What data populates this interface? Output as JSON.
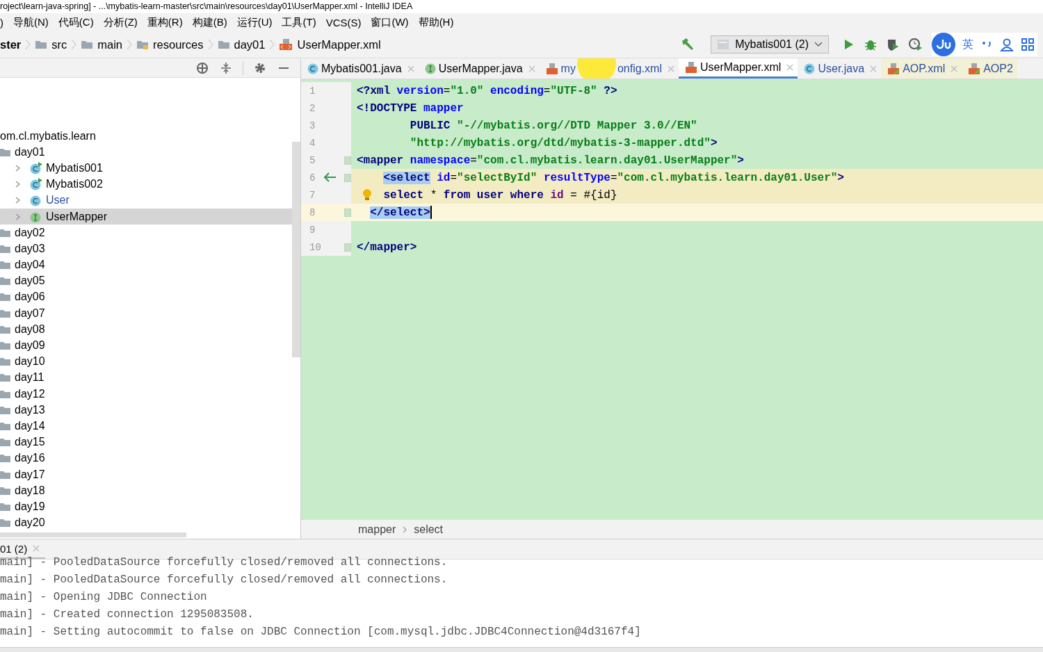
{
  "window": {
    "title": "roject\\learn-java-spring] - ...\\mybatis-learn-master\\src\\main\\resources\\day01\\UserMapper.xml - IntelliJ IDEA"
  },
  "menu": [
    ")",
    "导航(N)",
    "代码(C)",
    "分析(Z)",
    "重构(R)",
    "构建(B)",
    "运行(U)",
    "工具(T)",
    "VCS(S)",
    "窗口(W)",
    "帮助(H)"
  ],
  "breadcrumb": [
    {
      "label": "ster",
      "kind": "module"
    },
    {
      "label": "src",
      "kind": "folder"
    },
    {
      "label": "main",
      "kind": "folder"
    },
    {
      "label": "resources",
      "kind": "resources"
    },
    {
      "label": "day01",
      "kind": "folder"
    },
    {
      "label": "UserMapper.xml",
      "kind": "xml"
    }
  ],
  "run_config": {
    "label": "Mybatis001 (2)"
  },
  "ime": {
    "language": "英"
  },
  "project_tree": [
    {
      "label": "om.cl.mybatis.learn",
      "selected": false,
      "children": [
        {
          "label": "day01",
          "kind": "folder",
          "selected": false,
          "children": [
            {
              "label": "Mybatis001",
              "kind": "class-run",
              "selected": false
            },
            {
              "label": "Mybatis002",
              "kind": "class-run",
              "selected": false
            },
            {
              "label": "User",
              "kind": "class",
              "selected": false
            },
            {
              "label": "UserMapper",
              "kind": "interface",
              "selected": true
            }
          ]
        },
        {
          "label": "day02",
          "kind": "folder",
          "selected": false
        },
        {
          "label": "day03",
          "kind": "folder",
          "selected": false
        },
        {
          "label": "day04",
          "kind": "folder",
          "selected": false
        },
        {
          "label": "day05",
          "kind": "folder",
          "selected": false
        },
        {
          "label": "day06",
          "kind": "folder",
          "selected": false
        },
        {
          "label": "day07",
          "kind": "folder",
          "selected": false
        },
        {
          "label": "day08",
          "kind": "folder",
          "selected": false
        },
        {
          "label": "day09",
          "kind": "folder",
          "selected": false
        },
        {
          "label": "day10",
          "kind": "folder",
          "selected": false
        },
        {
          "label": "day11",
          "kind": "folder",
          "selected": false
        },
        {
          "label": "day12",
          "kind": "folder",
          "selected": false
        },
        {
          "label": "day13",
          "kind": "folder",
          "selected": false
        },
        {
          "label": "day14",
          "kind": "folder",
          "selected": false
        },
        {
          "label": "day15",
          "kind": "folder",
          "selected": false
        },
        {
          "label": "day16",
          "kind": "folder",
          "selected": false
        },
        {
          "label": "day17",
          "kind": "folder",
          "selected": false
        },
        {
          "label": "day18",
          "kind": "folder",
          "selected": false
        },
        {
          "label": "day19",
          "kind": "folder",
          "selected": false
        },
        {
          "label": "day20",
          "kind": "folder",
          "selected": false
        }
      ]
    }
  ],
  "editor_tabs": [
    {
      "label": "Mybatis001.java",
      "kind": "class",
      "selected": false
    },
    {
      "label": "UserMapper.java",
      "kind": "interface",
      "selected": false
    },
    {
      "label": "my",
      "label_end": "onfig.xml",
      "kind": "xml",
      "selected": false
    },
    {
      "label": "UserMapper.xml",
      "kind": "xml",
      "selected": true
    },
    {
      "label": "User.java",
      "kind": "class",
      "selected": false
    },
    {
      "label": "AOP.xml",
      "kind": "spring",
      "selected": false
    },
    {
      "label": "AOP2",
      "kind": "spring",
      "selected": false
    }
  ],
  "code_lines": [
    {
      "number": "1",
      "kind": "plain",
      "fold": false,
      "highlighted": false,
      "current": false,
      "tokens": [
        {
          "t": "<?xml ",
          "kind": "tag"
        },
        {
          "t": "version",
          "kind": "attr"
        },
        {
          "t": "=",
          "kind": "text"
        },
        {
          "t": "\"1.0\" ",
          "kind": "str"
        },
        {
          "t": "encoding",
          "kind": "attr"
        },
        {
          "t": "=",
          "kind": "text"
        },
        {
          "t": "\"UTF-8\"",
          "kind": "str"
        },
        {
          "t": " ?>",
          "kind": "tag"
        }
      ]
    },
    {
      "number": "2",
      "kind": "plain",
      "fold": false,
      "highlighted": false,
      "current": false,
      "tokens": [
        {
          "t": "<!DOCTYPE ",
          "kind": "tag"
        },
        {
          "t": "mapper",
          "kind": "attr"
        }
      ]
    },
    {
      "number": "3",
      "kind": "plain",
      "fold": false,
      "highlighted": false,
      "current": false,
      "tokens": [
        {
          "t": "        PUBLIC ",
          "kind": "tag"
        },
        {
          "t": "\"-//mybatis.org//DTD Mapper 3.0//EN\"",
          "kind": "str"
        }
      ]
    },
    {
      "number": "4",
      "kind": "plain",
      "fold": false,
      "highlighted": false,
      "current": false,
      "tokens": [
        {
          "t": "        \"http://mybatis.org/dtd/mybatis-3-mapper.dtd\"",
          "kind": "str"
        },
        {
          "t": ">",
          "kind": "tag"
        }
      ]
    },
    {
      "number": "5",
      "kind": "plain",
      "fold": true,
      "highlighted": false,
      "current": false,
      "tokens": [
        {
          "t": "<mapper ",
          "kind": "tag"
        },
        {
          "t": "namespace",
          "kind": "attr"
        },
        {
          "t": "=",
          "kind": "text"
        },
        {
          "t": "\"com.cl.mybatis.learn.day01.UserMapper\"",
          "kind": "str"
        },
        {
          "t": ">",
          "kind": "tag"
        }
      ]
    },
    {
      "number": "6",
      "kind": "arrow",
      "fold": true,
      "highlighted": true,
      "current": false,
      "tokens": [
        {
          "t": "    <select",
          "kind": "tag-match"
        },
        {
          "t": " id",
          "kind": "attr"
        },
        {
          "t": "=",
          "kind": "text"
        },
        {
          "t": "\"selectById\" ",
          "kind": "str"
        },
        {
          "t": "resultType",
          "kind": "attr"
        },
        {
          "t": "=",
          "kind": "text"
        },
        {
          "t": "\"com.cl.mybatis.learn.day01.User\"",
          "kind": "str"
        },
        {
          "t": ">",
          "kind": "tag"
        }
      ]
    },
    {
      "number": "7",
      "kind": "bulb",
      "fold": false,
      "highlighted": true,
      "current": false,
      "tokens": [
        {
          "t": "    select ",
          "kind": "kw"
        },
        {
          "t": "* ",
          "kind": "text"
        },
        {
          "t": "from ",
          "kind": "kw"
        },
        {
          "t": "user ",
          "kind": "kw"
        },
        {
          "t": "where ",
          "kind": "kw"
        },
        {
          "t": "id",
          "kind": "col"
        },
        {
          "t": " = #{id}",
          "kind": "text"
        }
      ]
    },
    {
      "number": "8",
      "kind": "plain",
      "fold": true,
      "highlighted": false,
      "current": true,
      "tokens": [
        {
          "t": "  </select>",
          "kind": "tag-match"
        }
      ]
    },
    {
      "number": "9",
      "kind": "plain",
      "fold": false,
      "highlighted": false,
      "current": false
    },
    {
      "number": "10",
      "kind": "plain",
      "fold": true,
      "highlighted": false,
      "current": false,
      "tokens": [
        {
          "t": "</mapper>",
          "kind": "tag"
        }
      ]
    }
  ],
  "editor_breadcrumb": [
    "mapper",
    "select"
  ],
  "bottom_tab": {
    "label": "01 (2)"
  },
  "console_lines": [
    "main] - PooledDataSource forcefully closed/removed all connections.",
    "main] - PooledDataSource forcefully closed/removed all connections.",
    "main] - Opening JDBC Connection",
    "main] - Created connection 1295083508.",
    "main] - Setting autocommit to false on JDBC Connection [com.mysql.jdbc.JDBC4Connection@4d3167f4]"
  ]
}
